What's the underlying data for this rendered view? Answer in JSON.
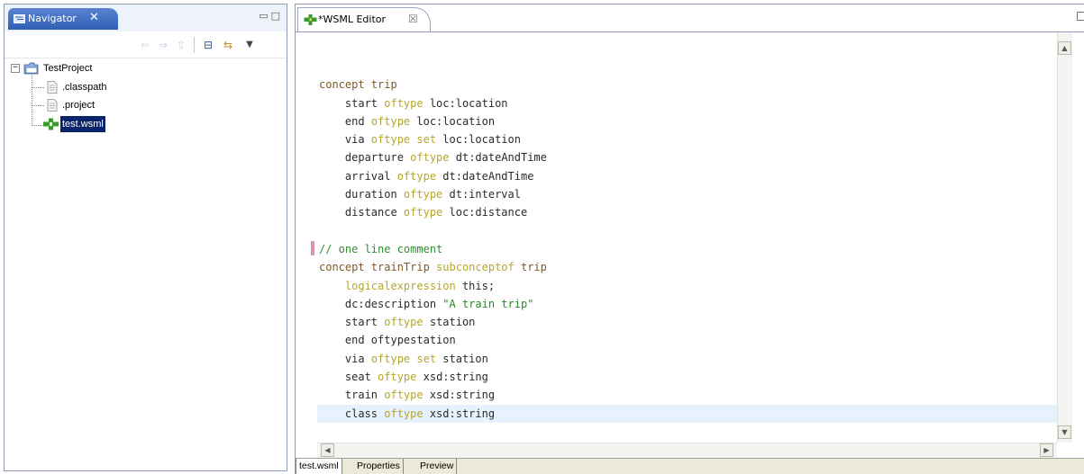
{
  "navigator": {
    "title": "Navigator",
    "close_glyph": "✕",
    "window_controls": "▭□",
    "toolbar": [
      {
        "name": "back-arrow-icon",
        "glyph": "⇐"
      },
      {
        "name": "forward-arrow-icon",
        "glyph": "⇒"
      },
      {
        "name": "up-folder-icon",
        "glyph": "⇧"
      },
      {
        "name": "collapse-all-icon",
        "glyph": "⊟"
      },
      {
        "name": "link-editor-icon",
        "glyph": "⇆"
      },
      {
        "name": "view-menu-icon",
        "glyph": "▼"
      }
    ],
    "tree": {
      "project": {
        "expander": "⊟",
        "label": "TestProject"
      },
      "children": [
        {
          "label": ".classpath",
          "selected": false,
          "icon": "file-icon"
        },
        {
          "label": ".project",
          "selected": false,
          "icon": "file-icon"
        },
        {
          "label": "test.wsml",
          "selected": true,
          "icon": "wsml-file-icon"
        }
      ]
    }
  },
  "editor": {
    "tab_title": "*WSML Editor",
    "tab_close_glyph": "☒",
    "code_lines": [
      [],
      [
        {
          "t": "concept trip",
          "c": "keyword"
        }
      ],
      [
        {
          "t": "    start ",
          "c": "plain"
        },
        {
          "t": "oftype",
          "c": "modifier"
        },
        {
          "t": " loc:location",
          "c": "plain"
        }
      ],
      [
        {
          "t": "    end ",
          "c": "plain"
        },
        {
          "t": "oftype",
          "c": "modifier"
        },
        {
          "t": " loc:location",
          "c": "plain"
        }
      ],
      [
        {
          "t": "    via ",
          "c": "plain"
        },
        {
          "t": "oftype set",
          "c": "modifier"
        },
        {
          "t": " loc:location",
          "c": "plain"
        }
      ],
      [
        {
          "t": "    departure ",
          "c": "plain"
        },
        {
          "t": "oftype",
          "c": "modifier"
        },
        {
          "t": " dt:dateAndTime",
          "c": "plain"
        }
      ],
      [
        {
          "t": "    arrival ",
          "c": "plain"
        },
        {
          "t": "oftype",
          "c": "modifier"
        },
        {
          "t": " dt:dateAndTime",
          "c": "plain"
        }
      ],
      [
        {
          "t": "    duration ",
          "c": "plain"
        },
        {
          "t": "oftype",
          "c": "modifier"
        },
        {
          "t": " dt:interval",
          "c": "plain"
        }
      ],
      [
        {
          "t": "    distance ",
          "c": "plain"
        },
        {
          "t": "oftype",
          "c": "modifier"
        },
        {
          "t": " loc:distance",
          "c": "plain"
        }
      ],
      [],
      [
        {
          "t": "// one line comment",
          "c": "comment"
        }
      ],
      [
        {
          "t": "concept trainTrip ",
          "c": "keyword"
        },
        {
          "t": "subconceptof",
          "c": "modifier"
        },
        {
          "t": " trip",
          "c": "keyword"
        }
      ],
      [
        {
          "t": "    logicalexpression",
          "c": "modifier"
        },
        {
          "t": " this;",
          "c": "plain"
        }
      ],
      [
        {
          "t": "    dc:description ",
          "c": "plain"
        },
        {
          "t": "\"A train trip\"",
          "c": "string"
        }
      ],
      [
        {
          "t": "    start ",
          "c": "plain"
        },
        {
          "t": "oftype",
          "c": "modifier"
        },
        {
          "t": " station",
          "c": "plain"
        }
      ],
      [
        {
          "t": "    end oftypestation",
          "c": "plain"
        }
      ],
      [
        {
          "t": "    via ",
          "c": "plain"
        },
        {
          "t": "oftype set",
          "c": "modifier"
        },
        {
          "t": " station",
          "c": "plain"
        }
      ],
      [
        {
          "t": "    seat ",
          "c": "plain"
        },
        {
          "t": "oftype",
          "c": "modifier"
        },
        {
          "t": " xsd:string",
          "c": "plain"
        }
      ],
      [
        {
          "t": "    train ",
          "c": "plain"
        },
        {
          "t": "oftype",
          "c": "modifier"
        },
        {
          "t": " xsd:string",
          "c": "plain"
        }
      ],
      [
        {
          "t": "    class ",
          "c": "plain"
        },
        {
          "t": "oftype",
          "c": "modifier"
        },
        {
          "t": " xsd:string",
          "c": "plain"
        }
      ],
      []
    ],
    "scroll_up_glyph": "▲",
    "scroll_down_glyph": "▼",
    "scroll_left_glyph": "◀",
    "scroll_right_glyph": "▶",
    "bottom_tabs": [
      {
        "label": "test.wsml",
        "active": true
      },
      {
        "label": "Properties",
        "active": false
      },
      {
        "label": "Preview",
        "active": false
      }
    ]
  },
  "colors": {
    "selection": "#0a246a",
    "keyword": "#7a5a2a",
    "modifier": "#b6a62a",
    "comment": "#2f8f2f",
    "current_line": "#e8f2fe"
  }
}
